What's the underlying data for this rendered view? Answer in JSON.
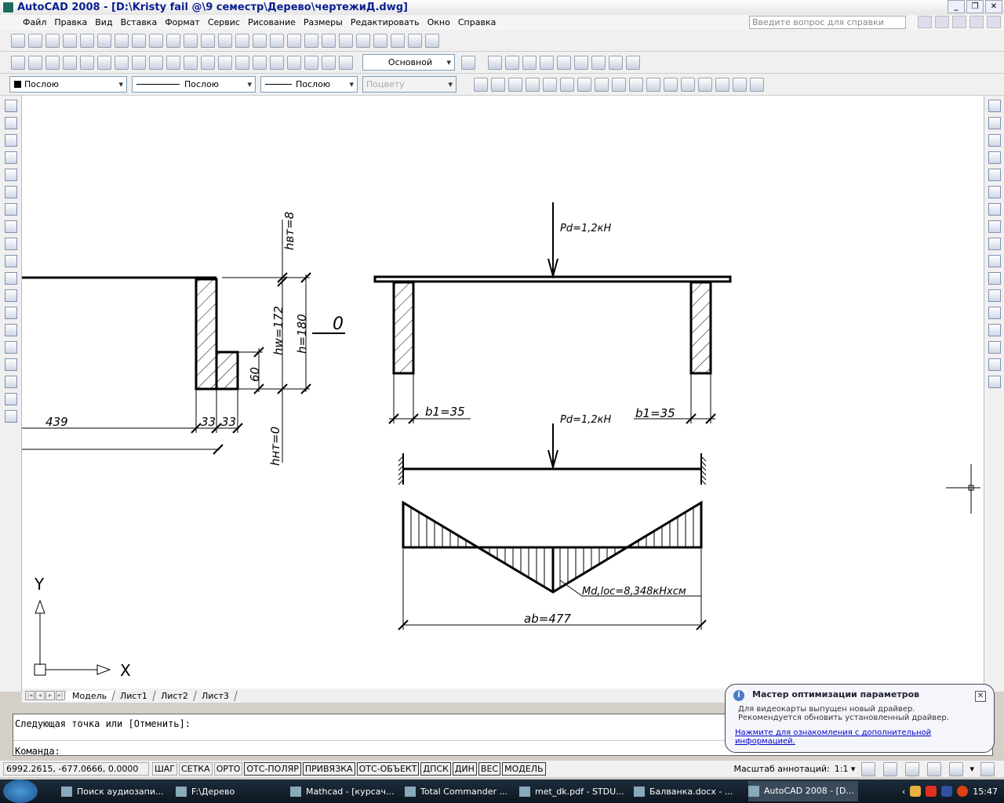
{
  "window": {
    "title": "AutoCAD 2008 - [D:\\Kristy fail @\\9 семестр\\Дерево\\чертежиД.dwg]"
  },
  "menu": [
    "Файл",
    "Правка",
    "Вид",
    "Вставка",
    "Формат",
    "Сервис",
    "Рисование",
    "Размеры",
    "Редактировать",
    "Окно",
    "Справка"
  ],
  "help": {
    "placeholder": "Введите вопрос для справки"
  },
  "toolbar": {
    "dimstyle": "Основной",
    "color": "Послою",
    "linetype": "Послою",
    "lineweight": "Послою",
    "plotstyle": "Поцвету"
  },
  "drawing": {
    "left": {
      "hvt": "hвт=8",
      "hw": "hw=172",
      "h": "h=180",
      "h60": "60",
      "hnt": "hнт=0",
      "d439": "439",
      "d33a": "33",
      "d33b": "33",
      "section": "0"
    },
    "right": {
      "load1": "Pd=1,2кН",
      "load2": "Pd=1,2кН",
      "b1_left": "b1=35",
      "b1_right": "b1=35",
      "moment": "Md,loc=8,348кНхсм",
      "span": "аb=477"
    },
    "ucs": {
      "x": "X",
      "y": "Y"
    }
  },
  "tabs": [
    "Модель",
    "Лист1",
    "Лист2",
    "Лист3"
  ],
  "command": {
    "history": "Следующая точка или [Отменить]:",
    "prompt": "Команда:"
  },
  "status": {
    "coords": "6992.2615, -677.0666, 0.0000",
    "buttons": [
      "ШАГ",
      "СЕТКА",
      "ОРТО",
      "ОТС-ПОЛЯР",
      "ПРИВЯЗКА",
      "ОТС-ОБЪЕКТ",
      "ДПСК",
      "ДИН",
      "ВЕС",
      "МОДЕЛЬ"
    ],
    "annotation_label": "Масштаб аннотаций:",
    "annotation_scale": "1:1"
  },
  "balloon": {
    "title": "Мастер оптимизации параметров",
    "line1": "Для видеокарты выпущен новый драйвер.",
    "line2": "Рекомендуется обновить установленный драйвер.",
    "link": "Нажмите для ознакомления с дополнительной информацией."
  },
  "taskbar": {
    "items": [
      "Поиск аудиозапи...",
      "F:\\Дерево",
      "Mathcad - [курсач...",
      "Total Commander ...",
      "met_dk.pdf - STDU...",
      "Балванка.docx - ...",
      "AutoCAD 2008 - [D..."
    ],
    "clock": "15:47"
  }
}
